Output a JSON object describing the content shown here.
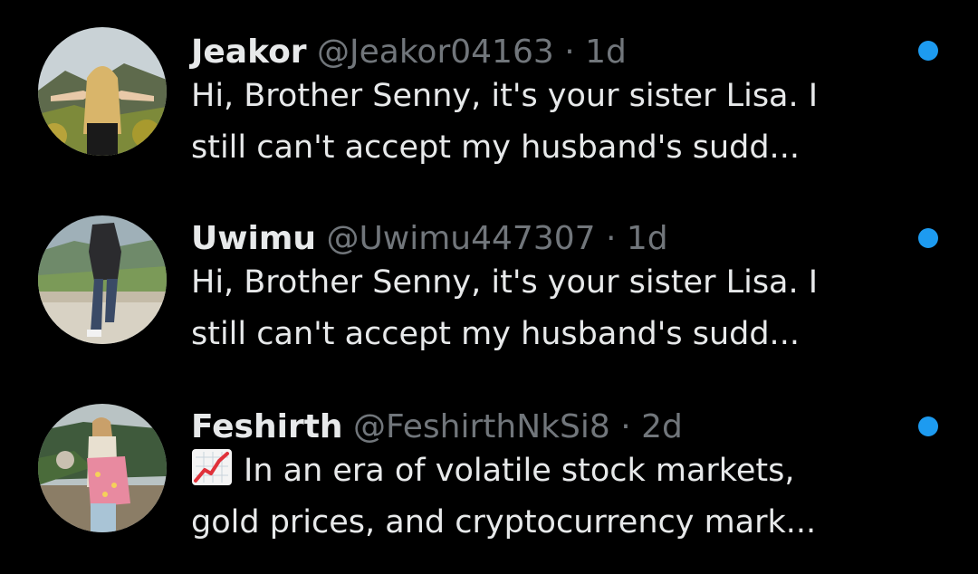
{
  "accent_color": "#1d9bf0",
  "background_color": "#000000",
  "messages": [
    {
      "name": "Jeakor",
      "handle": "@Jeakor04163",
      "separator": "·",
      "time": "1d",
      "preview_line1": "Hi, Brother Senny, it's your sister Lisa. I",
      "preview_line2": "still can't accept my husband's sudd...",
      "unread": true
    },
    {
      "name": "Uwimu",
      "handle": "@Uwimu447307",
      "separator": "·",
      "time": "1d",
      "preview_line1": "Hi, Brother Senny, it's your sister Lisa. I",
      "preview_line2": "still can't accept my husband's sudd...",
      "unread": true
    },
    {
      "name": "Feshirth",
      "handle": "@FeshirthNkSi8",
      "separator": "·",
      "time": "2d",
      "preview_icon": "chart-increasing-emoji-icon",
      "preview_line1": "In an era of volatile stock markets,",
      "preview_line2": "gold prices, and cryptocurrency mark...",
      "unread": true
    }
  ]
}
